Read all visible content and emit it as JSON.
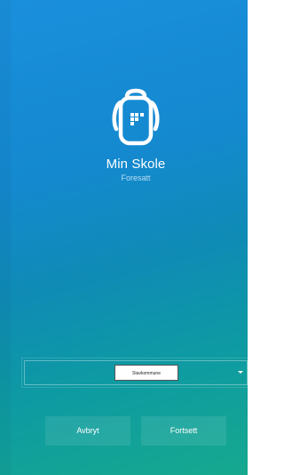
{
  "app": {
    "title": "Min Skole",
    "subtitle": "Foresatt",
    "logo_icon": "backpack-icon"
  },
  "municipality_select": {
    "selected": "Stavkommune"
  },
  "buttons": {
    "cancel_label": "Avbryt",
    "continue_label": "Fortsett"
  },
  "colors": {
    "gradient_top": "#1a8fdc",
    "gradient_bottom": "#16a98e",
    "text": "#ffffff"
  }
}
